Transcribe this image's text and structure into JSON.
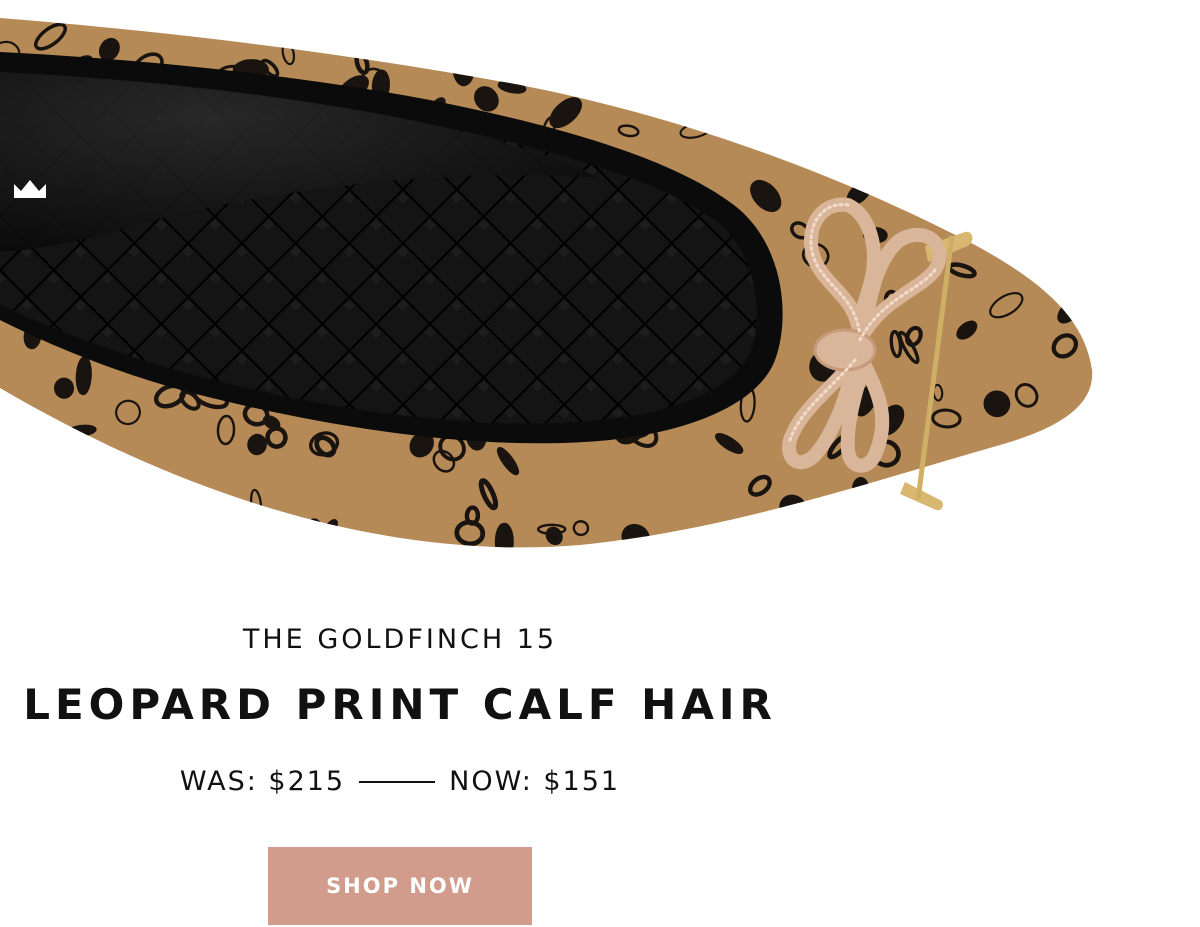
{
  "hero": {
    "image_label": "leopard-print-pointed-flat-with-crystal-bow",
    "insole_logo": "crown-logo-icon"
  },
  "product": {
    "collection": "THE GOLDFINCH 15",
    "name": "LEOPARD PRINT CALF HAIR",
    "was_label": "WAS: $215",
    "now_label": "NOW: $151"
  },
  "cta": {
    "label": "SHOP NOW",
    "color": "#d19c8c"
  },
  "colors": {
    "leopard_base": "#b58a56",
    "spot": "#1a1410",
    "insole": "#121212",
    "bow": "#d9b59a",
    "bar": "#d8b870"
  }
}
